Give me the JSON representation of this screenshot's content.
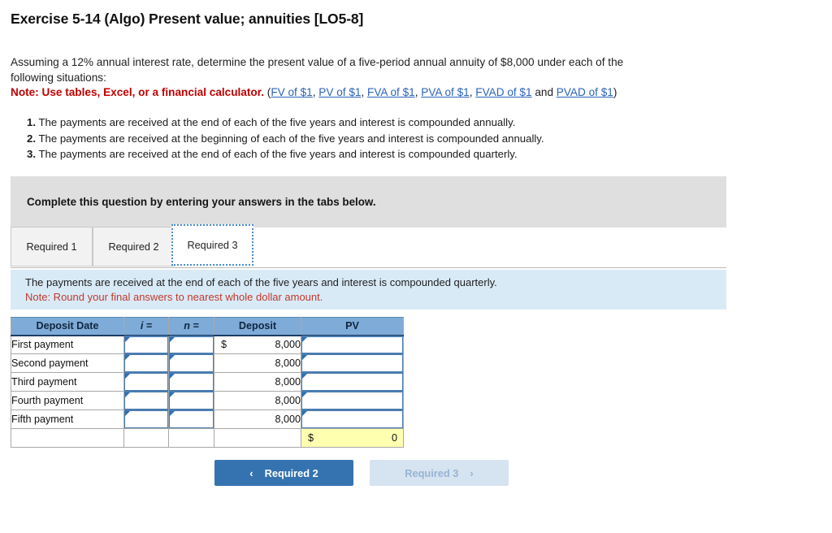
{
  "page": {
    "title": "Exercise 5-14 (Algo) Present value; annuities [LO5-8]"
  },
  "intro": {
    "line1": "Assuming a 12% annual interest rate, determine the present value of a five-period annual annuity of $8,000 under each of the",
    "line2": "following situations:",
    "note_label": "Note: Use tables, Excel, or a financial calculator.",
    "paren_open": " (",
    "paren_close": ")",
    "sep_comma": ", ",
    "sep_and": " and ",
    "links": [
      "FV of $1",
      "PV of $1",
      "FVA of $1",
      "PVA of $1",
      "FVAD of $1",
      "PVAD of $1"
    ]
  },
  "situations": [
    {
      "num": "1.",
      "text": "The payments are received at the end of each of the five years and interest is compounded annually."
    },
    {
      "num": "2.",
      "text": "The payments are received at the beginning of each of the five years and interest is compounded annually."
    },
    {
      "num": "3.",
      "text": "The payments are received at the end of each of the five years and interest is compounded quarterly."
    }
  ],
  "banner": {
    "text": "Complete this question by entering your answers in the tabs below."
  },
  "tabs": [
    {
      "label": "Required 1",
      "active": false
    },
    {
      "label": "Required 2",
      "active": false
    },
    {
      "label": "Required 3",
      "active": true
    }
  ],
  "info_panel": {
    "line1": "The payments are received at the end of each of the five years and interest is compounded quarterly.",
    "line2": "Note: Round your final answers to nearest whole dollar amount."
  },
  "table": {
    "headers": [
      "Deposit Date",
      "i =",
      "n =",
      "Deposit",
      "PV"
    ],
    "rows": [
      {
        "label": "First payment",
        "i": "",
        "n": "",
        "currency": "$",
        "deposit": "8,000",
        "pv": ""
      },
      {
        "label": "Second payment",
        "i": "",
        "n": "",
        "currency": "",
        "deposit": "8,000",
        "pv": ""
      },
      {
        "label": "Third payment",
        "i": "",
        "n": "",
        "currency": "",
        "deposit": "8,000",
        "pv": ""
      },
      {
        "label": "Fourth payment",
        "i": "",
        "n": "",
        "currency": "",
        "deposit": "8,000",
        "pv": ""
      },
      {
        "label": "Fifth payment",
        "i": "",
        "n": "",
        "currency": "",
        "deposit": "8,000",
        "pv": ""
      }
    ],
    "total": {
      "currency": "$",
      "value": "0"
    }
  },
  "nav": {
    "prev_label": "Required 2",
    "prev_chevron": "‹",
    "next_label": "Required 3",
    "next_chevron": "›"
  },
  "colors": {
    "header_blue": "#7fabd8",
    "panel_blue": "#d9eaf7",
    "banner_gray": "#dfdfdf",
    "note_red": "#c00000",
    "panel_note_red": "#c0392b",
    "link_blue": "#2a62bc",
    "button_blue": "#3572b0",
    "button_disabled": "#d6e3f0",
    "total_yellow": "#ffffb0",
    "input_border": "#4a7cb0"
  }
}
